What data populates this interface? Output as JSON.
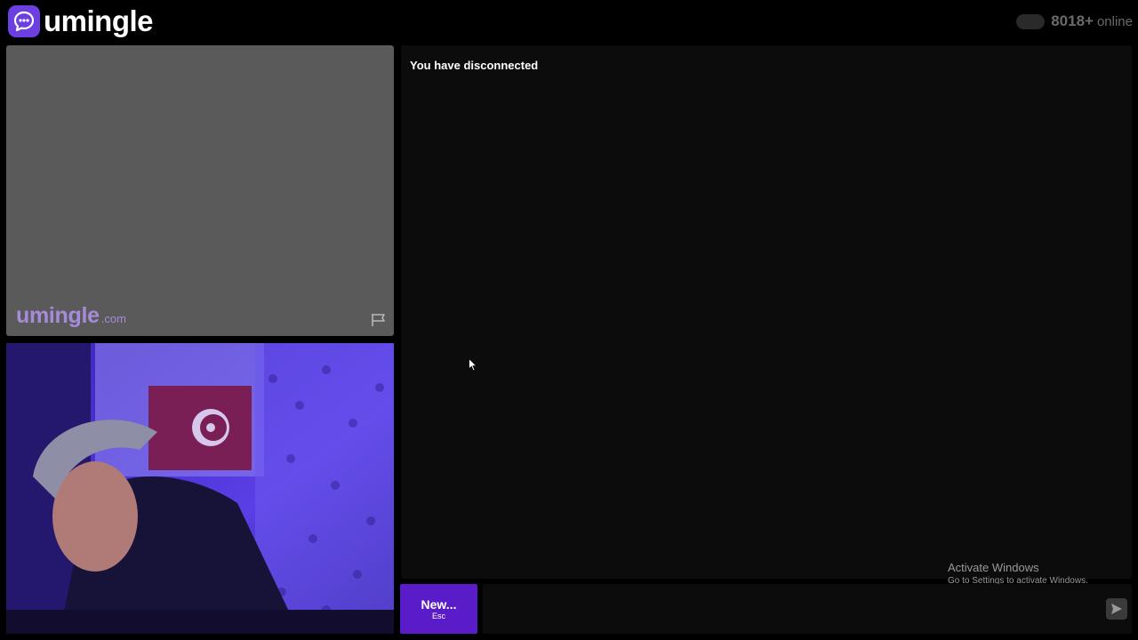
{
  "header": {
    "brand": "umingle",
    "online_count": "8018+",
    "online_label": "online"
  },
  "remote_video": {
    "watermark_main": "umingle",
    "watermark_sub": ".com"
  },
  "chat": {
    "status_message": "You have disconnected"
  },
  "controls": {
    "new_label": "New...",
    "new_shortcut": "Esc"
  },
  "os_overlay": {
    "title": "Activate Windows",
    "subtitle": "Go to Settings to activate Windows."
  },
  "colors": {
    "brand": "#6b3fe0",
    "new_button": "#5a1cc8",
    "watermark": "#a58bd9"
  },
  "icons": [
    "chat-bubble-icon",
    "flag-icon",
    "send-icon",
    "mouse-cursor-icon"
  ]
}
